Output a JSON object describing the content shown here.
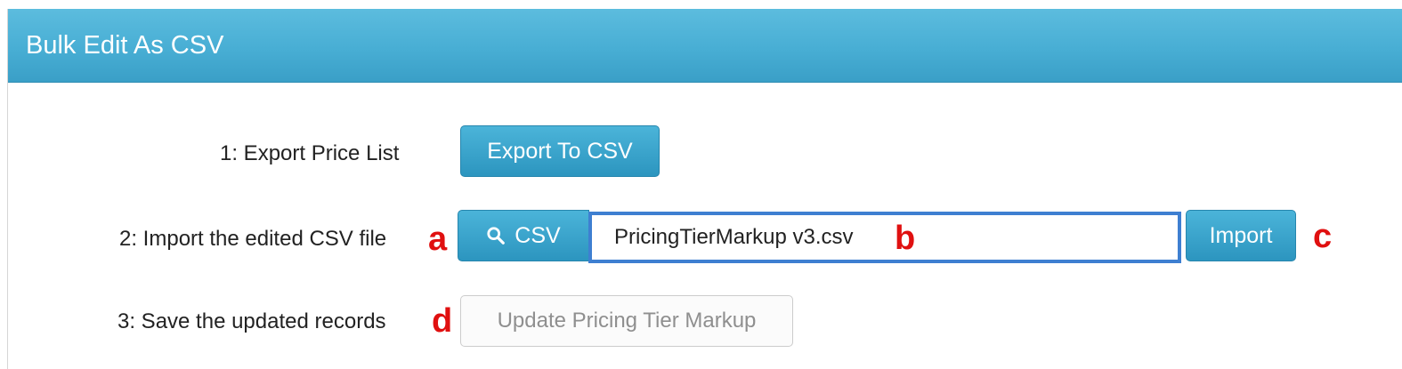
{
  "header": {
    "title": "Bulk Edit As CSV"
  },
  "rows": [
    {
      "label": "1: Export Price List",
      "button_label": "Export To CSV"
    },
    {
      "label": "2: Import the edited CSV file",
      "browse_label": "CSV",
      "browse_icon": "search-icon",
      "file_value": "PricingTierMarkup v3.csv",
      "import_label": "Import"
    },
    {
      "label": "3: Save the updated records",
      "button_label": "Update Pricing Tier Markup"
    }
  ],
  "annotations": {
    "a": "a",
    "b": "b",
    "c": "c",
    "d": "d"
  },
  "colors": {
    "header_blue": "#48aed4",
    "button_blue": "#2c95bf",
    "annotation_red": "#e01010",
    "focus_border": "#3e7fd1"
  }
}
